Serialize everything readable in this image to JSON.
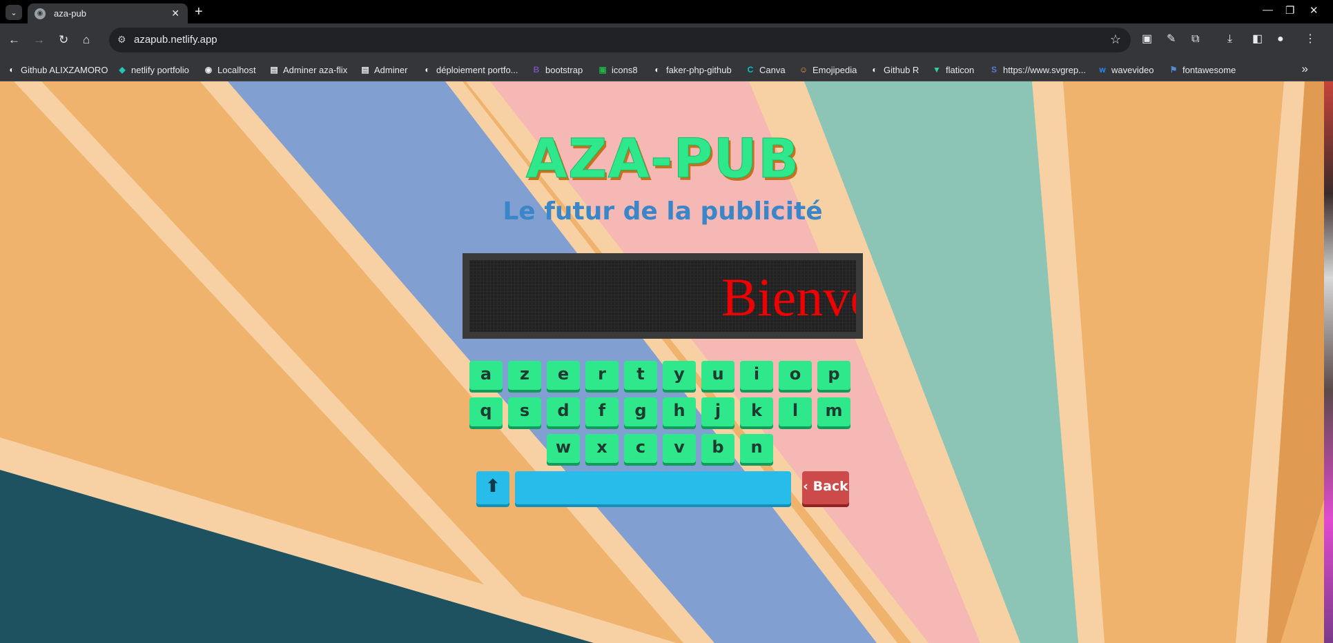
{
  "browser": {
    "tab_title": "aza-pub",
    "url": "azapub.netlify.app",
    "bookmarks": [
      {
        "label": "Github ALIXZAMORO",
        "icon": "github-icon",
        "color": "#ffffff"
      },
      {
        "label": "netlify portfolio",
        "icon": "netlify-icon",
        "color": "#20c6b7"
      },
      {
        "label": "Localhost",
        "icon": "globe-icon",
        "color": "#e8eaed"
      },
      {
        "label": "Adminer aza-flix",
        "icon": "adminer-icon",
        "color": "#e8eaed"
      },
      {
        "label": "Adminer",
        "icon": "adminer-icon",
        "color": "#e8eaed"
      },
      {
        "label": "déploiement portfo...",
        "icon": "github-icon",
        "color": "#ffffff"
      },
      {
        "label": "bootstrap",
        "icon": "bootstrap-icon",
        "color": "#7952b3"
      },
      {
        "label": "icons8",
        "icon": "icons8-icon",
        "color": "#1fb141"
      },
      {
        "label": "faker-php-github",
        "icon": "github-icon",
        "color": "#ffffff"
      },
      {
        "label": "Canva",
        "icon": "canva-icon",
        "color": "#00c4cc"
      },
      {
        "label": "Emojipedia",
        "icon": "emojipedia-icon",
        "color": "#f29e39"
      },
      {
        "label": "Github R",
        "icon": "github-icon",
        "color": "#ffffff"
      },
      {
        "label": "flaticon",
        "icon": "flaticon-icon",
        "color": "#2bd3a8"
      },
      {
        "label": "https://www.svgrep...",
        "icon": "svgrepo-icon",
        "color": "#5a7bd8"
      },
      {
        "label": "wavevideo",
        "icon": "wavevideo-icon",
        "color": "#1e8fff"
      },
      {
        "label": "fontawesome",
        "icon": "flag-icon",
        "color": "#538dd7"
      }
    ]
  },
  "page": {
    "logo": "AZA-PUB",
    "subtitle": "Le futur de la publicité",
    "display_text": "Bienvenue",
    "keyboard": {
      "row1": [
        "a",
        "z",
        "e",
        "r",
        "t",
        "y",
        "u",
        "i",
        "o",
        "p"
      ],
      "row2": [
        "q",
        "s",
        "d",
        "f",
        "g",
        "h",
        "j",
        "k",
        "l",
        "m"
      ],
      "row3": [
        "w",
        "x",
        "c",
        "v",
        "b",
        "n"
      ],
      "shift_label": "⬆",
      "back_label": "‹ Back"
    }
  }
}
